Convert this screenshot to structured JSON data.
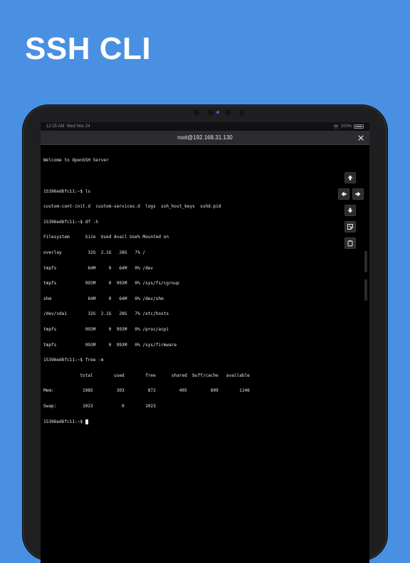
{
  "headline": "SSH CLI",
  "status_bar": {
    "time": "12:25 AM",
    "date": "Wed Nov 24",
    "battery": "100%"
  },
  "title_bar": {
    "title": "root@192.168.31.130"
  },
  "terminal": {
    "lines": [
      "Welcome to OpenSSH Server",
      "",
      "15396ed6fc11:~$ ls",
      "custom-cont-init.d  custom-services.d  logs  ssh_host_keys  sshd.pid",
      "15396ed6fc11:~$ df -h",
      "Filesystem      Size  Used Avail Use% Mounted on",
      "overlay          32G  2.1G   28G   7% /",
      "tmpfs            64M     0   64M   0% /dev",
      "tmpfs           993M     0  993M   0% /sys/fs/cgroup",
      "shm              64M     0   64M   0% /dev/shm",
      "/dev/vda1        32G  2.1G   28G   7% /etc/hosts",
      "tmpfs           993M     0  993M   0% /proc/acpi",
      "tmpfs           993M     0  993M   0% /sys/firmware",
      "15396ed6fc11:~$ free -m",
      "              total        used        free      shared  buff/cache   available",
      "Mem:           1985         303         872         405         809        1146",
      "Swap:          1023           0        1023"
    ],
    "prompt": "15396ed6fc11:~$ "
  },
  "controls": {
    "up": "arrow-up-icon",
    "left": "arrow-left-icon",
    "right": "arrow-right-icon",
    "down": "arrow-down-icon",
    "snippet": "sticky-note-icon",
    "clipboard": "clipboard-icon"
  },
  "colors": {
    "background": "#4a90e2",
    "terminal_bg": "#000000",
    "terminal_text": "#e8e8e8"
  }
}
